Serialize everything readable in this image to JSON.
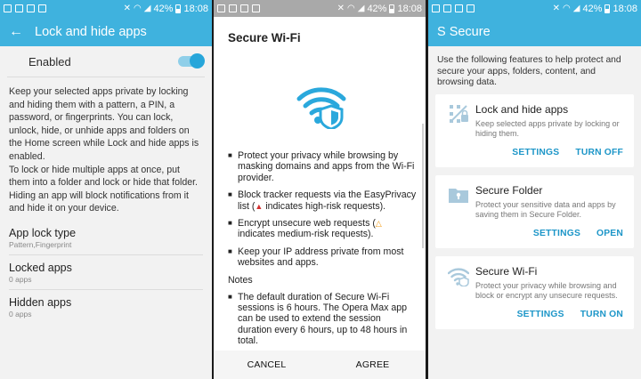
{
  "statusbar": {
    "battery": "42%",
    "time": "18:08"
  },
  "lock_screen": {
    "title": "Lock and hide apps",
    "enabled_label": "Enabled",
    "description": [
      "Keep your selected apps private by locking and hiding them with a pattern, a PIN, a password, or fingerprints. You can lock, unlock, hide, or unhide apps and folders on the Home screen while Lock and hide apps is enabled.",
      "To lock or hide multiple apps at once, put them into a folder and lock or hide that folder. Hiding an app will block notifications from it and hide it on your device."
    ],
    "settings": [
      {
        "title": "App lock type",
        "sub": "Pattern,Fingerprint"
      },
      {
        "title": "Locked apps",
        "sub": "0 apps"
      },
      {
        "title": "Hidden apps",
        "sub": "0 apps"
      }
    ]
  },
  "wifi_dialog": {
    "title": "Secure Wi-Fi",
    "bullets": [
      "Protect your privacy while browsing by masking domains and apps from the Wi-Fi provider.",
      {
        "pre": "Block tracker requests via the EasyPrivacy list (",
        "post": " indicates high-risk requests)."
      },
      {
        "pre": "Encrypt unsecure web requests (",
        "post": " indicates medium-risk requests)."
      },
      "Keep your IP address private from most websites and apps."
    ],
    "notes_label": "Notes",
    "note": "The default duration of Secure Wi-Fi sessions is 6 hours. The Opera Max app can be used to extend the session duration every 6 hours, up to 48 hours in total.",
    "cancel": "CANCEL",
    "agree": "AGREE"
  },
  "s_secure": {
    "title": "S Secure",
    "intro": "Use the following features to help protect and secure your apps, folders, content, and browsing data.",
    "cards": [
      {
        "title": "Lock and hide apps",
        "desc": "Keep selected apps private by locking or hiding them.",
        "actions": [
          "SETTINGS",
          "TURN OFF"
        ]
      },
      {
        "title": "Secure Folder",
        "desc": "Protect your sensitive data and apps by saving them in Secure Folder.",
        "actions": [
          "SETTINGS",
          "OPEN"
        ]
      },
      {
        "title": "Secure Wi-Fi",
        "desc": "Protect your privacy while browsing and block or encrypt any unsecure requests.",
        "actions": [
          "SETTINGS",
          "TURN ON"
        ]
      }
    ]
  },
  "colors": {
    "accent": "#3fb2de",
    "link": "#1d96c8",
    "high_risk": "#d32f2f",
    "medium_risk": "#f39c12"
  },
  "icons": [
    "back-arrow-icon",
    "wifi-shield-icon",
    "lock-grid-icon",
    "secure-folder-icon",
    "secure-wifi-icon"
  ]
}
